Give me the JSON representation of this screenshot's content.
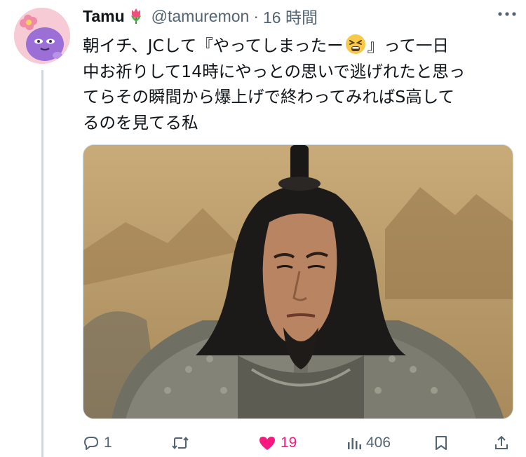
{
  "tweet": {
    "author": {
      "display_name": "Tamu",
      "name_emoji": "tulip",
      "handle": "@tamuremon",
      "separator": "·",
      "time": "16 時間"
    },
    "text_part1": "朝イチ、JCして『やってしまったー",
    "text_emoji": "tired-face",
    "text_part2": "』って一日\n中お祈りして14時にやっとの思いで逃げれたと思っ\nてらその瞬間から爆上げで終わってみればS高して\nるのを見てる私",
    "image_alt": "meme-photo"
  },
  "actions": {
    "reply_count": "1",
    "retweet_count": "",
    "like_count": "19",
    "views_count": "406",
    "liked": true
  },
  "colors": {
    "text_primary": "#0f1419",
    "text_secondary": "#536471",
    "like_pink": "#f91880",
    "thread_line": "#cfd9de"
  }
}
